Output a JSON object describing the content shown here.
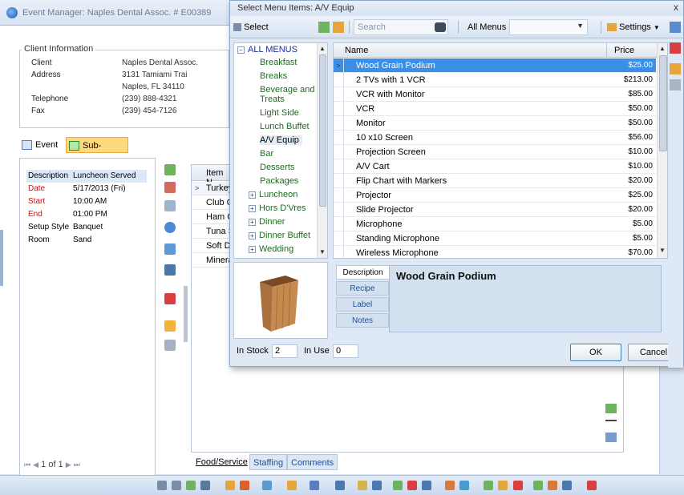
{
  "main_window": {
    "title": "Event Manager: Naples Dental Assoc. # E00389",
    "client_info": {
      "legend": "Client Information",
      "rows": [
        {
          "label": "Client",
          "value": "Naples Dental Assoc."
        },
        {
          "label": "Address",
          "value": "3131 Tamiami Trai"
        },
        {
          "label": "",
          "value": "Naples, FL 34110"
        },
        {
          "label": "Telephone",
          "value": "(239) 888-4321"
        },
        {
          "label": "Fax",
          "value": "(239) 454-7126"
        }
      ]
    },
    "event_tabs": [
      {
        "label": "Event",
        "active": false
      },
      {
        "label": "Sub-Event",
        "active": true
      }
    ],
    "details": [
      {
        "label": "Description",
        "value": "Luncheon Served",
        "red": false,
        "highlight": true
      },
      {
        "label": "Date",
        "value": "5/17/2013 (Fri)",
        "red": true,
        "highlight": false
      },
      {
        "label": "Start",
        "value": "10:00 AM",
        "red": true,
        "highlight": false
      },
      {
        "label": "End",
        "value": "01:00 PM",
        "red": true,
        "highlight": false
      },
      {
        "label": "Setup Style",
        "value": "Banquet",
        "red": false,
        "highlight": false
      },
      {
        "label": "Room",
        "value": "Sand",
        "red": false,
        "highlight": false
      }
    ],
    "pager": {
      "text": "1 of 1"
    },
    "items_grid": {
      "header": "Item N",
      "rows": [
        "Turkey",
        "Club C",
        "Ham C",
        "Tuna S",
        "Soft D",
        "Minera"
      ]
    },
    "bottom_tabs": [
      {
        "label": "Food/Service",
        "active": true
      },
      {
        "label": "Staffing",
        "active": false
      },
      {
        "label": "Comments",
        "active": false
      }
    ]
  },
  "dialog": {
    "title": "Select Menu Items: A/V Equip",
    "close": "x",
    "toolbar": {
      "select_label": "Select",
      "search_placeholder": "Search",
      "menus_label": "All Menus",
      "settings_label": "Settings"
    },
    "tree": {
      "root": "ALL MENUS",
      "items": [
        {
          "label": "Breakfast",
          "expandable": false,
          "selected": false
        },
        {
          "label": "Breaks",
          "expandable": false,
          "selected": false
        },
        {
          "label": "Beverage and",
          "expandable": false,
          "selected": false
        },
        {
          "label": "Treats",
          "expandable": false,
          "selected": false
        },
        {
          "label": "Light Side",
          "expandable": false,
          "selected": false
        },
        {
          "label": "Lunch Buffet",
          "expandable": false,
          "selected": false
        },
        {
          "label": "A/V Equip",
          "expandable": false,
          "selected": true
        },
        {
          "label": "Bar",
          "expandable": false,
          "selected": false
        },
        {
          "label": "Desserts",
          "expandable": false,
          "selected": false
        },
        {
          "label": "Packages",
          "expandable": false,
          "selected": false
        },
        {
          "label": "Luncheon",
          "expandable": true,
          "selected": false
        },
        {
          "label": "Hors D'Vres",
          "expandable": true,
          "selected": false
        },
        {
          "label": "Dinner",
          "expandable": true,
          "selected": false
        },
        {
          "label": "Dinner Buffet",
          "expandable": true,
          "selected": false
        },
        {
          "label": "Wedding",
          "expandable": true,
          "selected": false
        }
      ]
    },
    "grid": {
      "col_name": "Name",
      "col_price": "Price",
      "rows": [
        {
          "name": "Wood Grain Podium",
          "price": "$25.00",
          "selected": true
        },
        {
          "name": "2 TVs with 1 VCR",
          "price": "$213.00",
          "selected": false
        },
        {
          "name": "VCR with Monitor",
          "price": "$85.00",
          "selected": false
        },
        {
          "name": "VCR",
          "price": "$50.00",
          "selected": false
        },
        {
          "name": "Monitor",
          "price": "$50.00",
          "selected": false
        },
        {
          "name": "10  x10 Screen",
          "price": "$56.00",
          "selected": false
        },
        {
          "name": "Projection Screen",
          "price": "$10.00",
          "selected": false
        },
        {
          "name": "A/V Cart",
          "price": "$10.00",
          "selected": false
        },
        {
          "name": "Flip Chart with Markers",
          "price": "$20.00",
          "selected": false
        },
        {
          "name": "Projector",
          "price": "$25.00",
          "selected": false
        },
        {
          "name": "Slide Projector",
          "price": "$20.00",
          "selected": false
        },
        {
          "name": "Microphone",
          "price": "$5.00",
          "selected": false
        },
        {
          "name": "Standing Microphone",
          "price": "$5.00",
          "selected": false
        },
        {
          "name": "Wireless Microphone",
          "price": "$70.00",
          "selected": false
        }
      ]
    },
    "detail_tabs": [
      "Description",
      "Recipe",
      "Label",
      "Notes"
    ],
    "description_text": "Wood Grain Podium",
    "stock": {
      "in_stock_label": "In Stock",
      "in_stock_value": "2",
      "in_use_label": "In Use",
      "in_use_value": "0"
    },
    "buttons": {
      "ok": "OK",
      "cancel": "Cancel"
    }
  },
  "colors": {
    "selected_row": "#3b8fe6",
    "active_tab": "#ffd97e",
    "required_label": "#d01010",
    "tree_item": "#1f6b1f"
  }
}
